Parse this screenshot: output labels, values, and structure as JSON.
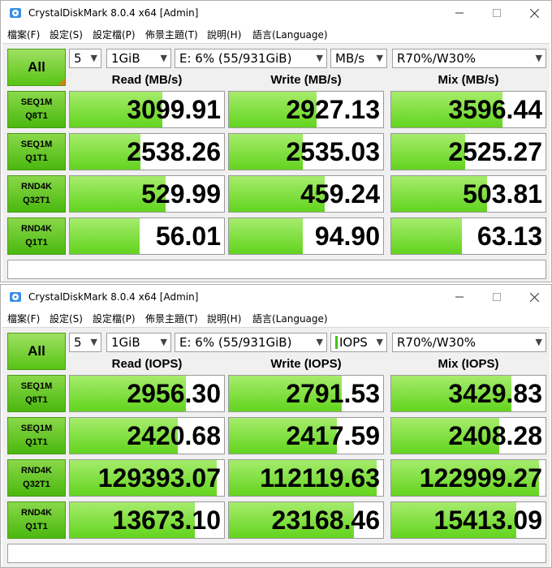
{
  "windows": [
    {
      "title": "CrystalDiskMark 8.0.4 x64 [Admin]",
      "menu": [
        "檔案(F)",
        "設定(S)",
        "設定檔(P)",
        "佈景主題(T)",
        "說明(H)",
        "語言(Language)"
      ],
      "all_label": "All",
      "controls": {
        "count": "5",
        "size": "1GiB",
        "drive": "E: 6% (55/931GiB)",
        "unit": "MB/s",
        "profile": "R70%/W30%"
      },
      "headers": [
        "Read (MB/s)",
        "Write (MB/s)",
        "Mix (MB/s)"
      ],
      "rows": [
        {
          "line1": "SEQ1M",
          "line2": "Q8T1",
          "values": [
            "3099.91",
            "2927.13",
            "3596.44"
          ],
          "fill": [
            0.6,
            0.57,
            0.72
          ]
        },
        {
          "line1": "SEQ1M",
          "line2": "Q1T1",
          "values": [
            "2538.26",
            "2535.03",
            "2525.27"
          ],
          "fill": [
            0.46,
            0.48,
            0.48
          ]
        },
        {
          "line1": "RND4K",
          "line2": "Q32T1",
          "values": [
            "529.99",
            "459.24",
            "503.81"
          ],
          "fill": [
            0.62,
            0.62,
            0.62
          ]
        },
        {
          "line1": "RND4K",
          "line2": "Q1T1",
          "values": [
            "56.01",
            "94.90",
            "63.13"
          ],
          "fill": [
            0.45,
            0.48,
            0.46
          ]
        }
      ]
    },
    {
      "title": "CrystalDiskMark 8.0.4 x64 [Admin]",
      "menu": [
        "檔案(F)",
        "設定(S)",
        "設定檔(P)",
        "佈景主題(T)",
        "說明(H)",
        "語言(Language)"
      ],
      "all_label": "All",
      "controls": {
        "count": "5",
        "size": "1GiB",
        "drive": "E: 6% (55/931GiB)",
        "unit": "IOPS",
        "profile": "R70%/W30%"
      },
      "headers": [
        "Read (IOPS)",
        "Write (IOPS)",
        "Mix (IOPS)"
      ],
      "rows": [
        {
          "line1": "SEQ1M",
          "line2": "Q8T1",
          "values": [
            "2956.30",
            "2791.53",
            "3429.83"
          ],
          "fill": [
            0.75,
            0.73,
            0.78
          ]
        },
        {
          "line1": "SEQ1M",
          "line2": "Q1T1",
          "values": [
            "2420.68",
            "2417.59",
            "2408.28"
          ],
          "fill": [
            0.7,
            0.7,
            0.7
          ]
        },
        {
          "line1": "RND4K",
          "line2": "Q32T1",
          "values": [
            "129393.07",
            "112119.63",
            "122999.27"
          ],
          "fill": [
            0.95,
            0.96,
            0.96
          ]
        },
        {
          "line1": "RND4K",
          "line2": "Q1T1",
          "values": [
            "13673.10",
            "23168.46",
            "15413.09"
          ],
          "fill": [
            0.81,
            0.81,
            0.81
          ]
        }
      ]
    }
  ],
  "colors": {
    "accent_green": "#5cc81a",
    "light_green": "#a6ec6c",
    "border_green": "#4c9a1e",
    "corner_orange": "#e07a1a"
  },
  "icons": {
    "app": "crystaldiskmark-icon",
    "minimize": "minimize-icon",
    "maximize": "maximize-icon",
    "close": "close-icon",
    "dropdown": "chevron-down-icon"
  }
}
